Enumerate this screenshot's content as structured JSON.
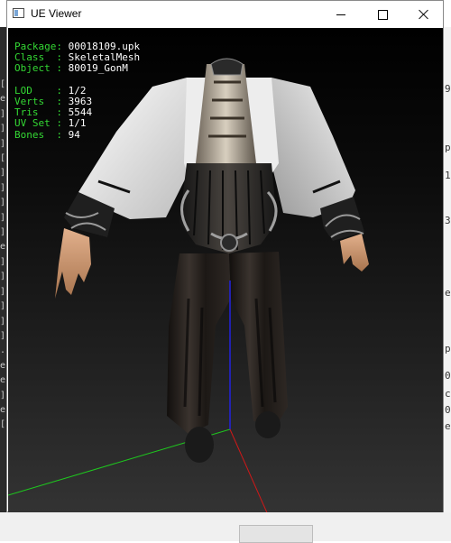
{
  "window": {
    "title": "UE Viewer",
    "icon": "app-window-icon",
    "controls": [
      "minimize-icon",
      "maximize-icon",
      "close-icon"
    ]
  },
  "info_panel": {
    "rows": [
      {
        "key": "Package",
        "value": "00018109.upk"
      },
      {
        "key": "Class  ",
        "value": "SkeletalMesh"
      },
      {
        "key": "Object ",
        "value": "80019_GonM"
      }
    ],
    "stats": [
      {
        "key": "LOD    ",
        "value": "1/2"
      },
      {
        "key": "Verts  ",
        "value": "3963"
      },
      {
        "key": "Tris   ",
        "value": "5544"
      },
      {
        "key": "UV Set ",
        "value": "1/1"
      },
      {
        "key": "Bones  ",
        "value": "94"
      }
    ],
    "separator": ": "
  },
  "axes": {
    "x_color": "#d01818",
    "y_color": "#1ec81e",
    "z_color": "#2222e0"
  },
  "background_left_marks": [
    "[",
    "e",
    "]",
    "]",
    "]",
    "[",
    "]",
    "]",
    "]",
    "]",
    "]",
    "e",
    "]",
    "]",
    "]",
    "]",
    "]",
    "]",
    ".",
    "e",
    "e",
    "]",
    "e",
    "["
  ],
  "background_right_marks": [
    "9",
    "p",
    "1",
    "3",
    "e",
    "p",
    "0",
    "c",
    "0",
    "e"
  ]
}
